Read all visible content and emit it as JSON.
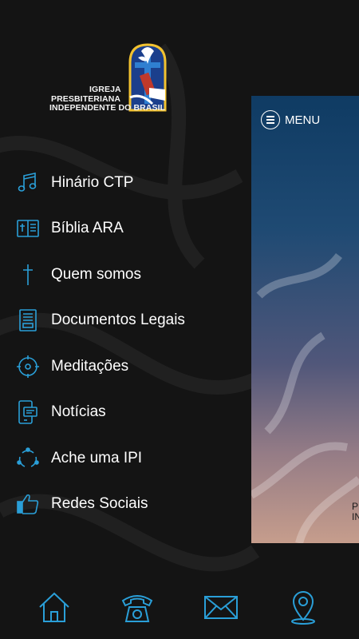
{
  "logo": {
    "line1": "IGREJA",
    "line2": "PRESBITERIANA",
    "line3": "INDEPENDENTE DO BRASIL"
  },
  "menu": {
    "items": [
      {
        "label": "Hinário CTP",
        "icon": "music-note-icon"
      },
      {
        "label": "Bíblia ARA",
        "icon": "bible-book-icon"
      },
      {
        "label": "Quem somos",
        "icon": "cross-icon"
      },
      {
        "label": "Documentos Legais",
        "icon": "document-icon"
      },
      {
        "label": "Meditações",
        "icon": "compass-target-icon"
      },
      {
        "label": "Notícias",
        "icon": "phone-news-icon"
      },
      {
        "label": "Ache uma IPI",
        "icon": "network-share-icon"
      },
      {
        "label": "Redes Sociais",
        "icon": "thumbs-up-icon"
      }
    ]
  },
  "panel": {
    "menu_label": "MENU",
    "foot_line1": "P",
    "foot_line2": "IN"
  },
  "bottom_bar": {
    "icons": [
      "home-icon",
      "telephone-icon",
      "mail-icon",
      "location-pin-icon"
    ]
  },
  "colors": {
    "accent": "#2a9fd8",
    "background": "#141414"
  }
}
